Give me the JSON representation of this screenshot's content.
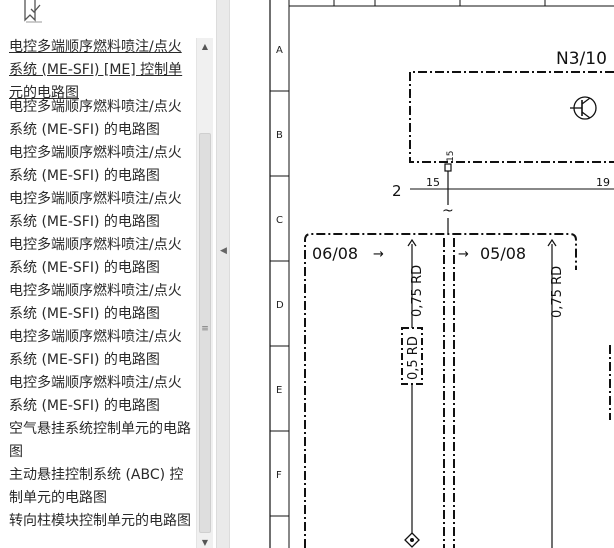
{
  "sidebar": {
    "items": [
      {
        "label": "电控多端顺序燃料喷注/点火系统 (ME-SFI) [ME] 控制单元的电路图",
        "selected": true
      },
      {
        "label": "电控多端顺序燃料喷注/点火系统 (ME-SFI) 的电路图"
      },
      {
        "label": "电控多端顺序燃料喷注/点火系统 (ME-SFI) 的电路图"
      },
      {
        "label": "电控多端顺序燃料喷注/点火系统 (ME-SFI) 的电路图"
      },
      {
        "label": "电控多端顺序燃料喷注/点火系统 (ME-SFI) 的电路图"
      },
      {
        "label": "电控多端顺序燃料喷注/点火系统 (ME-SFI) 的电路图"
      },
      {
        "label": "电控多端顺序燃料喷注/点火系统 (ME-SFI) 的电路图"
      },
      {
        "label": "电控多端顺序燃料喷注/点火系统 (ME-SFI) 的电路图"
      },
      {
        "label": "空气悬挂系统控制单元的电路图"
      },
      {
        "label": "主动悬挂控制系统 (ABC) 控制单元的电路图"
      },
      {
        "label": "转向柱模块控制单元的电路图"
      }
    ]
  },
  "toolbar": {
    "icon": "bookmark-icon"
  },
  "diagram": {
    "row_labels": [
      "A",
      "B",
      "C",
      "D",
      "E",
      "F"
    ],
    "component": "N3/10",
    "pin_15_vertical": "15",
    "pin_15": "15",
    "pin_19": "19",
    "node_2": "2",
    "tilde": "~",
    "ref_left": "06/08",
    "ref_right": "05/08",
    "wire_a": "0,75 RD",
    "wire_b": "0,5 RD",
    "wire_c": "0,75 RD",
    "accent_color": "#0b2fbf"
  }
}
